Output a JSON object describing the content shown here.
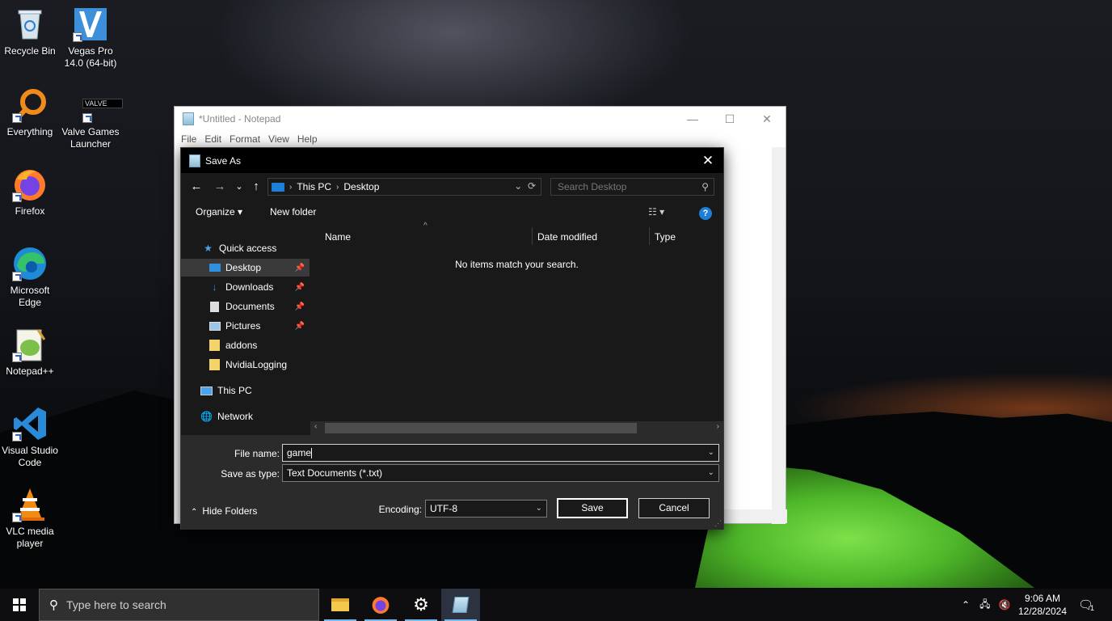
{
  "desktop": {
    "icons": [
      {
        "label": "Recycle Bin",
        "icon": "recycle-bin-icon"
      },
      {
        "label": "Vegas Pro 14.0 (64-bit)",
        "icon": "vegas-pro-icon"
      },
      {
        "label": "Everything",
        "icon": "everything-search-icon"
      },
      {
        "label": "Valve Games Launcher",
        "icon": "valve-games-icon"
      },
      {
        "label": "Firefox",
        "icon": "firefox-icon"
      },
      {
        "label": "Microsoft Edge",
        "icon": "edge-icon"
      },
      {
        "label": "Notepad++",
        "icon": "notepad-plus-plus-icon"
      },
      {
        "label": "Visual Studio Code",
        "icon": "vscode-icon"
      },
      {
        "label": "VLC media player",
        "icon": "vlc-icon"
      }
    ],
    "valve_badge_text": "VALVE"
  },
  "notepad": {
    "title": "*Untitled - Notepad",
    "menu": [
      "File",
      "Edit",
      "Format",
      "View",
      "Help"
    ],
    "controls": {
      "minimize": "—",
      "maximize": "☐",
      "close": "✕"
    }
  },
  "dialog": {
    "title": "Save As",
    "close": "✕",
    "nav": {
      "back": "←",
      "forward": "→",
      "recent": "⌄",
      "up": "↑"
    },
    "breadcrumb": [
      "This PC",
      "Desktop"
    ],
    "search_placeholder": "Search Desktop",
    "toolbar": {
      "organize": "Organize ▾",
      "new_folder": "New folder",
      "help": "?"
    },
    "nav_pane": [
      {
        "label": "Quick access",
        "icon": "star-icon",
        "pinned": false,
        "selected": false,
        "indent": 1
      },
      {
        "label": "Desktop",
        "icon": "desktop-folder-icon",
        "pinned": true,
        "selected": true,
        "indent": 2
      },
      {
        "label": "Downloads",
        "icon": "download-icon",
        "pinned": true,
        "selected": false,
        "indent": 2
      },
      {
        "label": "Documents",
        "icon": "documents-icon",
        "pinned": true,
        "selected": false,
        "indent": 2
      },
      {
        "label": "Pictures",
        "icon": "pictures-icon",
        "pinned": true,
        "selected": false,
        "indent": 2
      },
      {
        "label": "addons",
        "icon": "folder-icon",
        "pinned": false,
        "selected": false,
        "indent": 2
      },
      {
        "label": "NvidiaLogging",
        "icon": "folder-icon",
        "pinned": false,
        "selected": false,
        "indent": 2
      },
      {
        "label": "This PC",
        "icon": "computer-icon",
        "pinned": false,
        "selected": false,
        "indent": 1
      },
      {
        "label": "Network",
        "icon": "network-icon",
        "pinned": false,
        "selected": false,
        "indent": 1
      }
    ],
    "columns": [
      "Name",
      "Date modified",
      "Type"
    ],
    "empty_message": "No items match your search.",
    "file_name_label": "File name:",
    "file_name_value": "game",
    "save_type_label": "Save as type:",
    "save_type_value": "Text Documents (*.txt)",
    "hide_folders": "Hide Folders",
    "encoding_label": "Encoding:",
    "encoding_value": "UTF-8",
    "save_button": "Save",
    "cancel_button": "Cancel"
  },
  "taskbar": {
    "search_placeholder": "Type here to search",
    "apps": [
      "file-explorer-icon",
      "firefox-icon",
      "settings-gear-icon",
      "notepad-icon"
    ],
    "time": "9:06 AM",
    "date": "12/28/2024",
    "notification_count": "1"
  }
}
